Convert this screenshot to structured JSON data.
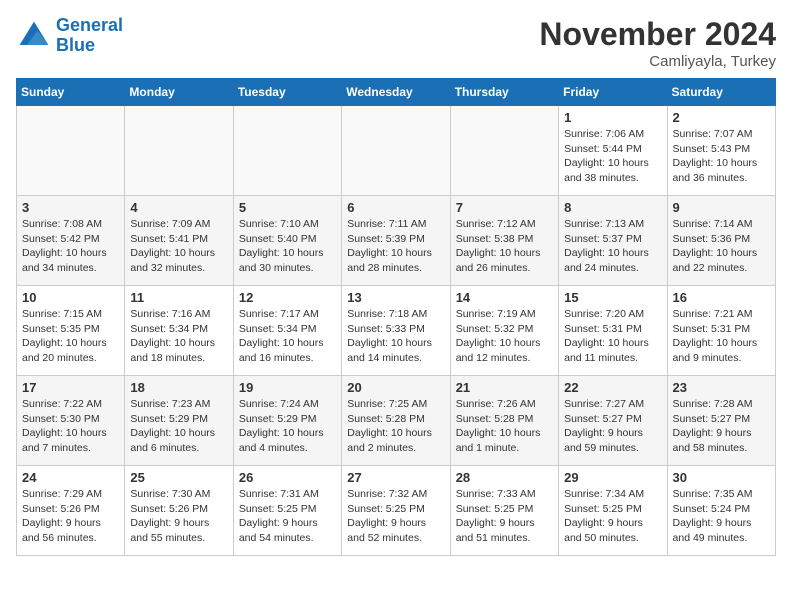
{
  "header": {
    "logo_line1": "General",
    "logo_line2": "Blue",
    "month_title": "November 2024",
    "location": "Camliyayla, Turkey"
  },
  "days_of_week": [
    "Sunday",
    "Monday",
    "Tuesday",
    "Wednesday",
    "Thursday",
    "Friday",
    "Saturday"
  ],
  "weeks": [
    [
      {
        "num": "",
        "info": ""
      },
      {
        "num": "",
        "info": ""
      },
      {
        "num": "",
        "info": ""
      },
      {
        "num": "",
        "info": ""
      },
      {
        "num": "",
        "info": ""
      },
      {
        "num": "1",
        "info": "Sunrise: 7:06 AM\nSunset: 5:44 PM\nDaylight: 10 hours and 38 minutes."
      },
      {
        "num": "2",
        "info": "Sunrise: 7:07 AM\nSunset: 5:43 PM\nDaylight: 10 hours and 36 minutes."
      }
    ],
    [
      {
        "num": "3",
        "info": "Sunrise: 7:08 AM\nSunset: 5:42 PM\nDaylight: 10 hours and 34 minutes."
      },
      {
        "num": "4",
        "info": "Sunrise: 7:09 AM\nSunset: 5:41 PM\nDaylight: 10 hours and 32 minutes."
      },
      {
        "num": "5",
        "info": "Sunrise: 7:10 AM\nSunset: 5:40 PM\nDaylight: 10 hours and 30 minutes."
      },
      {
        "num": "6",
        "info": "Sunrise: 7:11 AM\nSunset: 5:39 PM\nDaylight: 10 hours and 28 minutes."
      },
      {
        "num": "7",
        "info": "Sunrise: 7:12 AM\nSunset: 5:38 PM\nDaylight: 10 hours and 26 minutes."
      },
      {
        "num": "8",
        "info": "Sunrise: 7:13 AM\nSunset: 5:37 PM\nDaylight: 10 hours and 24 minutes."
      },
      {
        "num": "9",
        "info": "Sunrise: 7:14 AM\nSunset: 5:36 PM\nDaylight: 10 hours and 22 minutes."
      }
    ],
    [
      {
        "num": "10",
        "info": "Sunrise: 7:15 AM\nSunset: 5:35 PM\nDaylight: 10 hours and 20 minutes."
      },
      {
        "num": "11",
        "info": "Sunrise: 7:16 AM\nSunset: 5:34 PM\nDaylight: 10 hours and 18 minutes."
      },
      {
        "num": "12",
        "info": "Sunrise: 7:17 AM\nSunset: 5:34 PM\nDaylight: 10 hours and 16 minutes."
      },
      {
        "num": "13",
        "info": "Sunrise: 7:18 AM\nSunset: 5:33 PM\nDaylight: 10 hours and 14 minutes."
      },
      {
        "num": "14",
        "info": "Sunrise: 7:19 AM\nSunset: 5:32 PM\nDaylight: 10 hours and 12 minutes."
      },
      {
        "num": "15",
        "info": "Sunrise: 7:20 AM\nSunset: 5:31 PM\nDaylight: 10 hours and 11 minutes."
      },
      {
        "num": "16",
        "info": "Sunrise: 7:21 AM\nSunset: 5:31 PM\nDaylight: 10 hours and 9 minutes."
      }
    ],
    [
      {
        "num": "17",
        "info": "Sunrise: 7:22 AM\nSunset: 5:30 PM\nDaylight: 10 hours and 7 minutes."
      },
      {
        "num": "18",
        "info": "Sunrise: 7:23 AM\nSunset: 5:29 PM\nDaylight: 10 hours and 6 minutes."
      },
      {
        "num": "19",
        "info": "Sunrise: 7:24 AM\nSunset: 5:29 PM\nDaylight: 10 hours and 4 minutes."
      },
      {
        "num": "20",
        "info": "Sunrise: 7:25 AM\nSunset: 5:28 PM\nDaylight: 10 hours and 2 minutes."
      },
      {
        "num": "21",
        "info": "Sunrise: 7:26 AM\nSunset: 5:28 PM\nDaylight: 10 hours and 1 minute."
      },
      {
        "num": "22",
        "info": "Sunrise: 7:27 AM\nSunset: 5:27 PM\nDaylight: 9 hours and 59 minutes."
      },
      {
        "num": "23",
        "info": "Sunrise: 7:28 AM\nSunset: 5:27 PM\nDaylight: 9 hours and 58 minutes."
      }
    ],
    [
      {
        "num": "24",
        "info": "Sunrise: 7:29 AM\nSunset: 5:26 PM\nDaylight: 9 hours and 56 minutes."
      },
      {
        "num": "25",
        "info": "Sunrise: 7:30 AM\nSunset: 5:26 PM\nDaylight: 9 hours and 55 minutes."
      },
      {
        "num": "26",
        "info": "Sunrise: 7:31 AM\nSunset: 5:25 PM\nDaylight: 9 hours and 54 minutes."
      },
      {
        "num": "27",
        "info": "Sunrise: 7:32 AM\nSunset: 5:25 PM\nDaylight: 9 hours and 52 minutes."
      },
      {
        "num": "28",
        "info": "Sunrise: 7:33 AM\nSunset: 5:25 PM\nDaylight: 9 hours and 51 minutes."
      },
      {
        "num": "29",
        "info": "Sunrise: 7:34 AM\nSunset: 5:25 PM\nDaylight: 9 hours and 50 minutes."
      },
      {
        "num": "30",
        "info": "Sunrise: 7:35 AM\nSunset: 5:24 PM\nDaylight: 9 hours and 49 minutes."
      }
    ]
  ]
}
